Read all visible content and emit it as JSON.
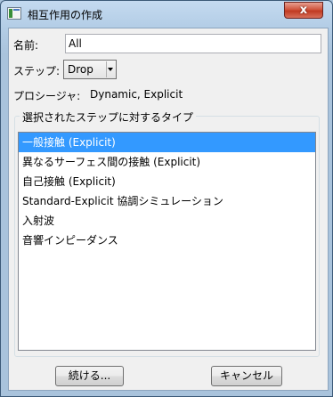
{
  "window": {
    "title": "相互作用の作成",
    "close_glyph": "x"
  },
  "form": {
    "name_label": "名前:",
    "name_value": "All",
    "step_label": "ステップ:",
    "step_value": "Drop",
    "procedure_label": "プロシージャ:",
    "procedure_value": "Dynamic, Explicit"
  },
  "types": {
    "group_label": "選択されたステップに対するタイプ",
    "selected_index": 0,
    "items": [
      {
        "label": "一般接触 (Explicit)"
      },
      {
        "label": "異なるサーフェス間の接触 (Explicit)"
      },
      {
        "label": "自己接触 (Explicit)"
      },
      {
        "label": "Standard-Explicit 協調シミュレーション"
      },
      {
        "label": "入射波"
      },
      {
        "label": "音響インピーダンス"
      }
    ]
  },
  "buttons": {
    "continue_label": "続ける...",
    "cancel_label": "キャンセル"
  },
  "colors": {
    "selection": "#3399ff",
    "close_button": "#c03a22"
  }
}
